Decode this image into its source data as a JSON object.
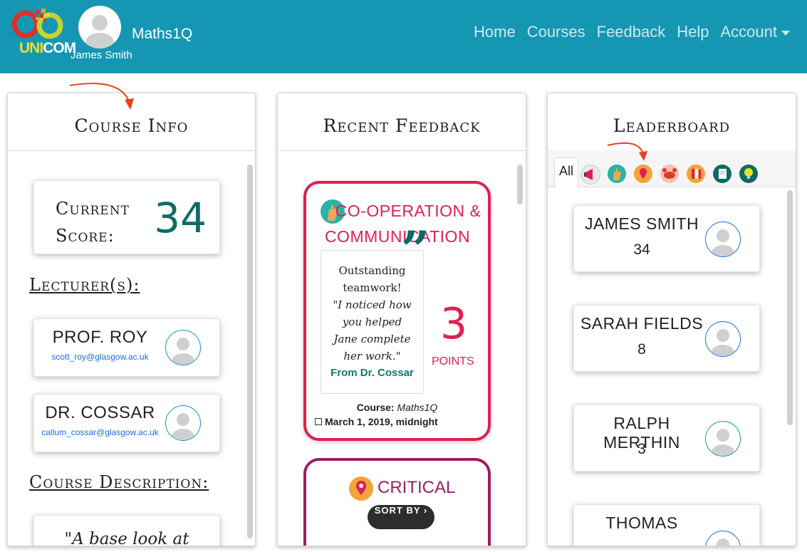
{
  "nav": {
    "logo_u": "UNI",
    "logo_c": "COM",
    "user_name": "James Smith",
    "brand": "Maths1Q",
    "links": [
      "Home",
      "Courses",
      "Feedback",
      "Help",
      "Account"
    ],
    "colors": {
      "bar": "#1597b3",
      "link": "#cfe9ef"
    }
  },
  "course_info": {
    "title": "Course Info",
    "score_label_1": "Current",
    "score_label_2": "Score:",
    "score_value": "34",
    "lecturers_heading": "Lecturer(s):",
    "lecturers": [
      {
        "name": "PROF. ROY",
        "email": "scott_roy@glasgow.ac.uk"
      },
      {
        "name": "DR. COSSAR",
        "email": "callum_cossar@glasgow.ac.uk"
      }
    ],
    "description_heading": "Course Description:",
    "description_preview": "\"A base look at"
  },
  "recent_feedback": {
    "title": "Recent Feedback",
    "cards": [
      {
        "title_line1": "CO-OPERATION &",
        "title_line2": "COMMUNICATION",
        "quote_line1": "Outstanding",
        "quote_line2": "teamwork!",
        "quote_line3": "\"I noticed how",
        "quote_line4": "you helped",
        "quote_line5": "Jane complete",
        "quote_line6": "her work.\"",
        "from": "From Dr. Cossar",
        "points": "3",
        "points_label": "POINTS",
        "course_label": "Course:",
        "course_name": "Maths1Q",
        "date": "March 1, 2019, midnight",
        "color": "#e0204f"
      },
      {
        "title_line1": "CRITICAL",
        "color": "#9b1f5c"
      }
    ],
    "sort_label": "SORT BY ›"
  },
  "leaderboard": {
    "title": "Leaderboard",
    "tab_all": "All",
    "tab_icons": [
      "megaphone-icon",
      "teamwork-icon",
      "location-pin-icon",
      "crab-icon",
      "books-icon",
      "notepad-icon",
      "lightbulb-icon"
    ],
    "entries": [
      {
        "name": "JAMES SMITH",
        "score": "34"
      },
      {
        "name": "SARAH FIELDS",
        "score": "8"
      },
      {
        "name": "RALPH MERTHIN",
        "score": "3"
      },
      {
        "name": "THOMAS",
        "score": ""
      }
    ]
  }
}
